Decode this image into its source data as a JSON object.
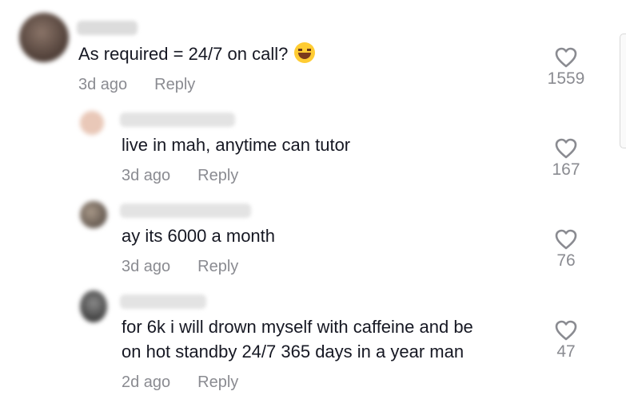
{
  "comments": [
    {
      "text": "As required = 24/7 on call?",
      "emoji": "laughing-tears-emoji",
      "time": "3d ago",
      "reply_label": "Reply",
      "likes": "1559",
      "avatar_color": "#6b5a50"
    },
    {
      "text": "live in mah, anytime can tutor",
      "time": "3d ago",
      "reply_label": "Reply",
      "likes": "167",
      "avatar_color": "#e3c2b2"
    },
    {
      "text": "ay its 6000 a month",
      "time": "3d ago",
      "reply_label": "Reply",
      "likes": "76",
      "avatar_color": "#8a7f74"
    },
    {
      "text_line1": "for 6k i will drown myself with caffeine and be",
      "text_line2": "on hot standby 24/7 365 days in a year man",
      "time": "2d ago",
      "reply_label": "Reply",
      "likes": "47",
      "avatar_color": "#6e6e6e"
    }
  ],
  "icons": {
    "like": "heart-outline-icon"
  }
}
